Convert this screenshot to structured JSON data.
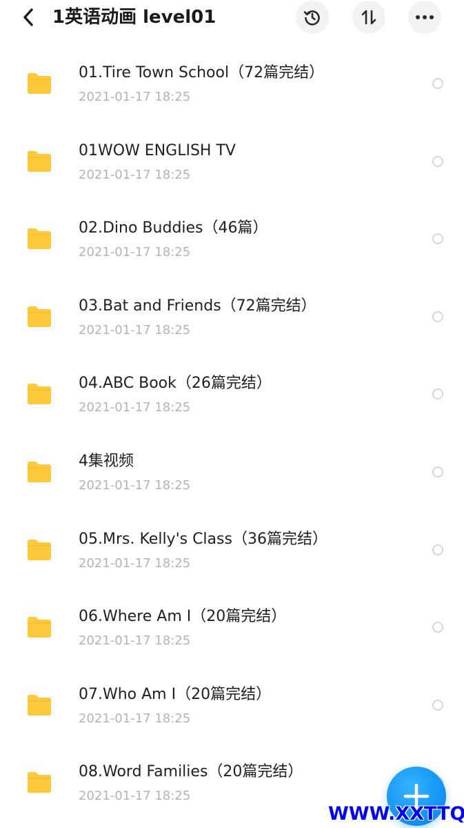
{
  "header": {
    "title": "1英语动画 level01",
    "back_icon": "chevron-left-icon",
    "history_icon": "history-icon",
    "sort_icon": "sort-icon",
    "more_icon": "more-horizontal-icon"
  },
  "colors": {
    "folder": "#FFC93C",
    "accent": "#1296F7",
    "date_text": "#B3B3B3",
    "title_text": "#1A1A1A",
    "watermark": "#0000FF"
  },
  "files": [
    {
      "name": "01.Tire Town School（72篇完结）",
      "date": "2021-01-17 18:25"
    },
    {
      "name": "01WOW ENGLISH TV",
      "date": "2021-01-17 18:25"
    },
    {
      "name": "02.Dino Buddies（46篇）",
      "date": "2021-01-17 18:25"
    },
    {
      "name": "03.Bat and Friends（72篇完结）",
      "date": "2021-01-17 18:25"
    },
    {
      "name": "04.ABC Book（26篇完结）",
      "date": "2021-01-17 18:25"
    },
    {
      "name": "4集视频",
      "date": "2021-01-17 18:25"
    },
    {
      "name": "05.Mrs. Kelly's Class（36篇完结）",
      "date": "2021-01-17 18:25"
    },
    {
      "name": "06.Where Am I（20篇完结）",
      "date": "2021-01-17 18:25"
    },
    {
      "name": "07.Who Am I（20篇完结）",
      "date": "2021-01-17 18:25"
    },
    {
      "name": "08.Word Families（20篇完结）",
      "date": "2021-01-17 18:25"
    }
  ],
  "fab": {
    "icon": "plus-icon"
  },
  "watermark": {
    "text": "WWW.XXTTQ.COM"
  }
}
